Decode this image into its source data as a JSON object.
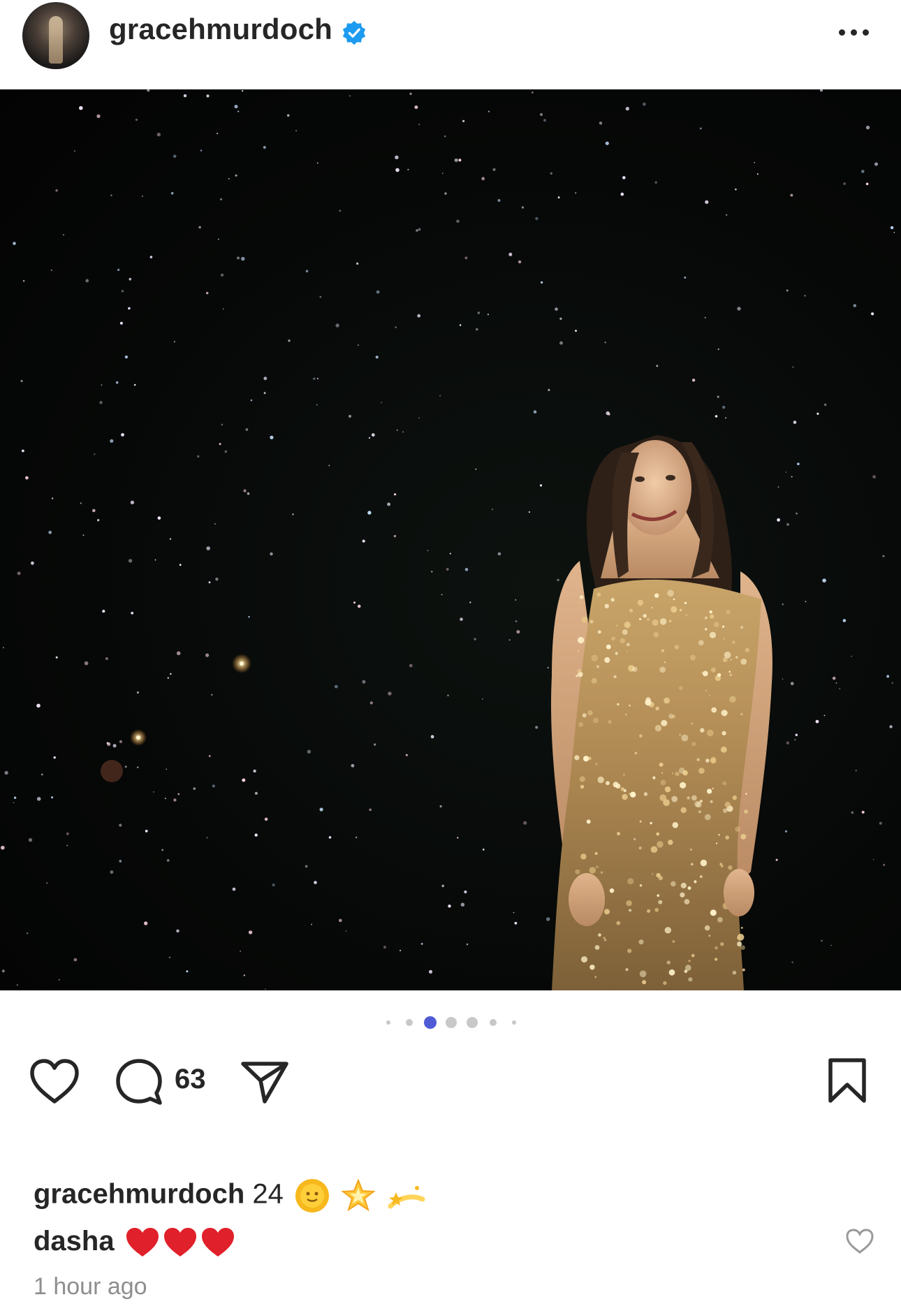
{
  "header": {
    "username": "gracehmurdoch",
    "verified_icon": "verified-badge-icon",
    "more_icon": "more-options-icon",
    "accent": "#1d9bf0"
  },
  "post": {
    "image_description_icon": "photo",
    "carousel": {
      "total": 7,
      "active_index": 2,
      "active_color": "#4f5bd5"
    },
    "comment_count": "63"
  },
  "caption": {
    "username": "gracehmurdoch",
    "text": "24",
    "emojis": [
      "sun-with-face",
      "glowing-star",
      "dizzy"
    ]
  },
  "comment": {
    "username": "dasha",
    "hearts": 3,
    "heart_color": "#e0202a"
  },
  "timestamp": "1 hour ago"
}
